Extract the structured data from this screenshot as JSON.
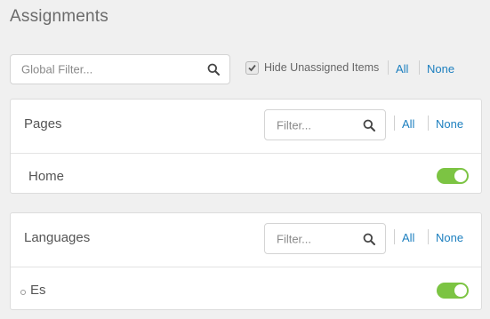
{
  "page": {
    "title": "Assignments"
  },
  "global_filter": {
    "placeholder": "Global Filter...",
    "icon": "search-icon"
  },
  "hide_unassigned": {
    "label": "Hide Unassigned Items",
    "checked": true
  },
  "top_links": {
    "all": "All",
    "none": "None"
  },
  "panels": [
    {
      "title": "Pages",
      "filter_placeholder": "Filter...",
      "all": "All",
      "none": "None",
      "items": [
        {
          "label": "Home",
          "enabled": true
        }
      ]
    },
    {
      "title": "Languages",
      "filter_placeholder": "Filter...",
      "all": "All",
      "none": "None",
      "items": [
        {
          "label": "Es",
          "enabled": true,
          "bullet": true
        }
      ]
    }
  ],
  "colors": {
    "accent": "#1c7fbf",
    "toggle_on": "#7cc443",
    "background": "#f0f0f0"
  }
}
